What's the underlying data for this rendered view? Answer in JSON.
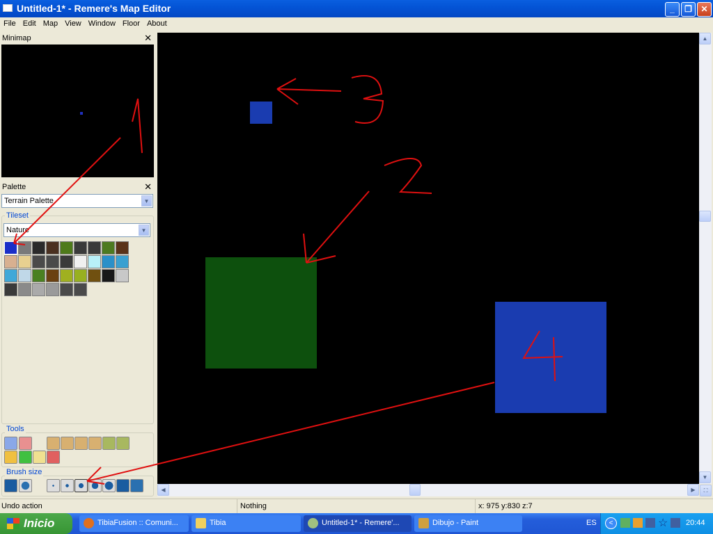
{
  "window": {
    "title": "Untitled-1* - Remere's Map Editor",
    "min": "_",
    "max": "❐",
    "close": "✕"
  },
  "menu": [
    "File",
    "Edit",
    "Map",
    "View",
    "Window",
    "Floor",
    "About"
  ],
  "minimap": {
    "title": "Minimap",
    "close": "✕"
  },
  "palette": {
    "title": "Palette",
    "close": "✕",
    "selected": "Terrain Palette",
    "tileset_label": "Tileset",
    "tileset": "Nature",
    "tools_label": "Tools",
    "brush_size_label": "Brush size"
  },
  "tiles": [
    "#1a2ec8",
    "#7a7a7a",
    "#2a2a2a",
    "#4a3020",
    "#4e7a1a",
    "#3a3a3a",
    "#3a3a3a",
    "#4d7a20",
    "#5a3218",
    "#d8b090",
    "#e8d090",
    "#4a4a4a",
    "#4a4a4a",
    "#3a3a3a",
    "#f0f0f0",
    "#b8f0f8",
    "#2a90c8",
    "#3aa0d0",
    "#40a8d8",
    "#c0d8e8",
    "#4a8020",
    "#6a4010",
    "#a0b020",
    "#98b020",
    "#705010",
    "#181818",
    "#c8c8c8",
    "#3a3a3a",
    "#8a8a8a",
    "#aaaaaa",
    "#9a9a9a",
    "#4a4a4a",
    "#4a4a4a"
  ],
  "status": {
    "left": "Undo action",
    "middle": "Nothing",
    "coords": "x: 975 y:830 z:7"
  },
  "taskbar": {
    "start": "Inicio",
    "tasks": [
      "TibiaFusion :: Comuni...",
      "Tibia",
      "Untitled-1* - Remere'...",
      "Dibujo - Paint"
    ],
    "lang": "ES",
    "clock": "20:44"
  },
  "colors": {
    "water": "#1a3cb0",
    "grass": "#0d500d",
    "annotation": "#e01010"
  }
}
